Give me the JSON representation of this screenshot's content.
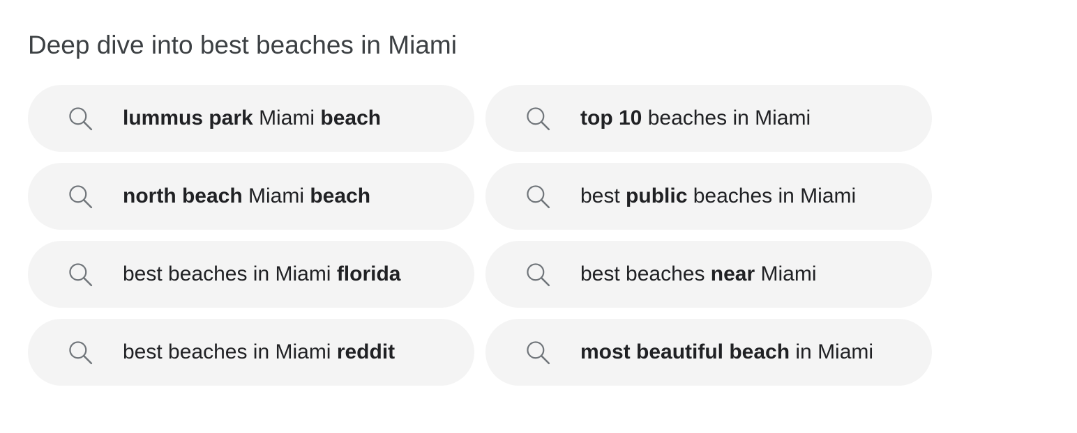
{
  "heading": "Deep dive into best beaches in Miami",
  "icon": "search-icon",
  "colors": {
    "chip_background": "#f4f4f4",
    "icon": "#70757a",
    "text": "#202124",
    "heading": "#3c4043"
  },
  "suggestions": [
    {
      "text": "lummus park Miami beach",
      "segments": [
        {
          "text": "lummus park",
          "bold": true
        },
        {
          "text": " Miami ",
          "bold": false
        },
        {
          "text": "beach",
          "bold": true
        }
      ]
    },
    {
      "text": "top 10 beaches in Miami",
      "segments": [
        {
          "text": "top 10",
          "bold": true
        },
        {
          "text": " beaches in Miami",
          "bold": false
        }
      ]
    },
    {
      "text": "north beach Miami beach",
      "segments": [
        {
          "text": "north beach",
          "bold": true
        },
        {
          "text": " Miami ",
          "bold": false
        },
        {
          "text": "beach",
          "bold": true
        }
      ]
    },
    {
      "text": "best public beaches in Miami",
      "segments": [
        {
          "text": "best ",
          "bold": false
        },
        {
          "text": "public",
          "bold": true
        },
        {
          "text": " beaches in Miami",
          "bold": false
        }
      ]
    },
    {
      "text": "best beaches in Miami florida",
      "segments": [
        {
          "text": "best beaches in Miami ",
          "bold": false
        },
        {
          "text": "florida",
          "bold": true
        }
      ]
    },
    {
      "text": "best beaches near Miami",
      "segments": [
        {
          "text": "best beaches ",
          "bold": false
        },
        {
          "text": "near",
          "bold": true
        },
        {
          "text": " Miami",
          "bold": false
        }
      ]
    },
    {
      "text": "best beaches in Miami reddit",
      "segments": [
        {
          "text": "best beaches in Miami ",
          "bold": false
        },
        {
          "text": "reddit",
          "bold": true
        }
      ]
    },
    {
      "text": "most beautiful beach in Miami",
      "segments": [
        {
          "text": "most beautiful beach",
          "bold": true
        },
        {
          "text": " in Miami",
          "bold": false
        }
      ]
    }
  ]
}
